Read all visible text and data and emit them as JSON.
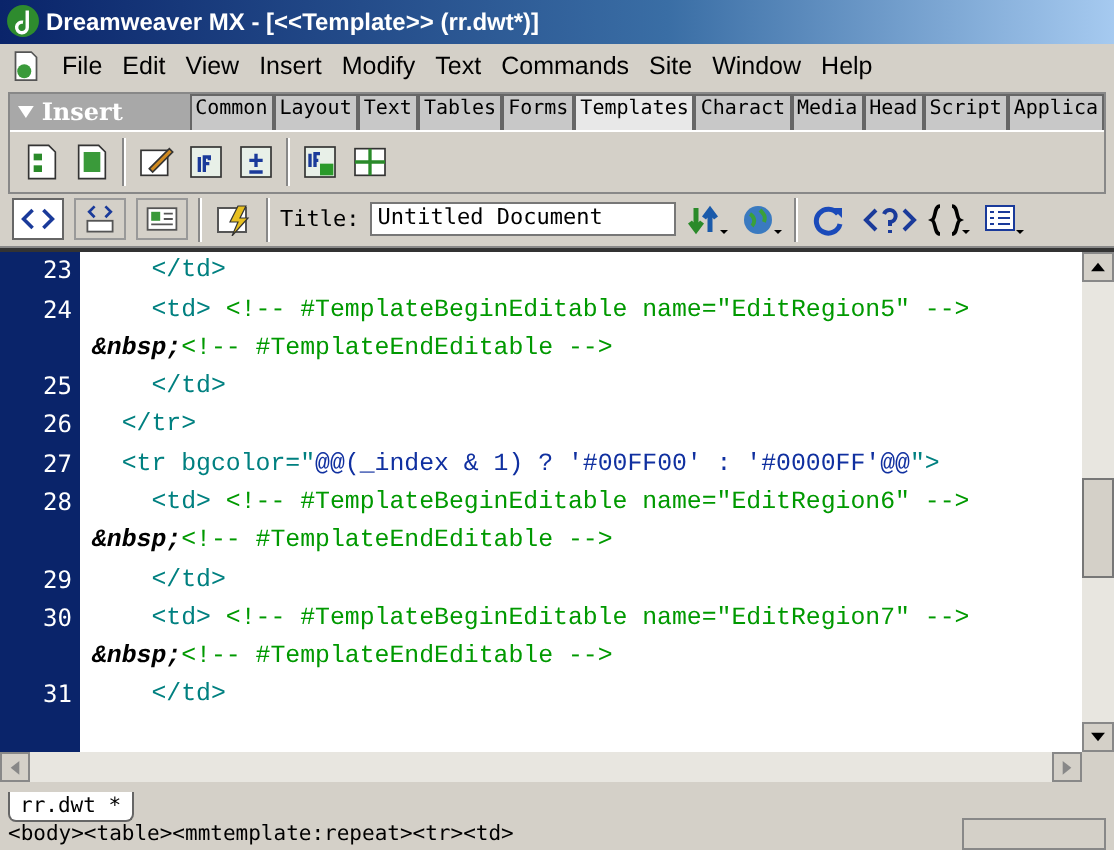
{
  "window": {
    "title": "Dreamweaver MX - [<<Template>>  (rr.dwt*)]"
  },
  "menu": [
    "File",
    "Edit",
    "View",
    "Insert",
    "Modify",
    "Text",
    "Commands",
    "Site",
    "Window",
    "Help"
  ],
  "insert_panel": {
    "title": "Insert",
    "tabs": [
      {
        "label": "Common",
        "selected": false
      },
      {
        "label": "Layout",
        "selected": false
      },
      {
        "label": "Text",
        "selected": false
      },
      {
        "label": "Tables",
        "selected": false
      },
      {
        "label": "Forms",
        "selected": false
      },
      {
        "label": "Templates",
        "selected": true
      },
      {
        "label": "Charact",
        "selected": false
      },
      {
        "label": "Media",
        "selected": false
      },
      {
        "label": "Head",
        "selected": false
      },
      {
        "label": "Script",
        "selected": false
      },
      {
        "label": "Applica",
        "selected": false
      }
    ]
  },
  "document_toolbar": {
    "views": [
      {
        "kind": "code",
        "selected": true
      },
      {
        "kind": "split",
        "selected": false
      },
      {
        "kind": "design",
        "selected": false
      }
    ],
    "title_label": "Title:",
    "title_value": "Untitled Document"
  },
  "code_lines": [
    {
      "number": "23",
      "segments": [
        {
          "kind": "tag",
          "text": "    </td>"
        }
      ]
    },
    {
      "number": "24",
      "segments": [
        {
          "kind": "tag",
          "text": "    <td> "
        },
        {
          "kind": "comment",
          "text": "<!-- #TemplateBeginEditable name=\"EditRegion5\" -->"
        }
      ]
    },
    {
      "segments": [
        {
          "kind": "entity",
          "text": "&nbsp;"
        },
        {
          "kind": "comment",
          "text": "<!-- #TemplateEndEditable -->"
        }
      ]
    },
    {
      "number": "25",
      "segments": [
        {
          "kind": "tag",
          "text": "    </td>"
        }
      ]
    },
    {
      "number": "26",
      "segments": [
        {
          "kind": "tag",
          "text": "  </tr>"
        }
      ]
    },
    {
      "number": "27",
      "segments": [
        {
          "kind": "tag",
          "text": "  <tr bgcolor=\""
        },
        {
          "kind": "expression",
          "text": "@@(_index & 1) ? '#00FF00' : '#0000FF'@@"
        },
        {
          "kind": "tag",
          "text": "\">"
        }
      ]
    },
    {
      "number": "28",
      "segments": [
        {
          "kind": "tag",
          "text": "    <td> "
        },
        {
          "kind": "comment",
          "text": "<!-- #TemplateBeginEditable name=\"EditRegion6\" -->"
        }
      ]
    },
    {
      "segments": [
        {
          "kind": "entity",
          "text": "&nbsp;"
        },
        {
          "kind": "comment",
          "text": "<!-- #TemplateEndEditable -->"
        }
      ]
    },
    {
      "number": "29",
      "segments": [
        {
          "kind": "tag",
          "text": "    </td>"
        }
      ]
    },
    {
      "number": "30",
      "segments": [
        {
          "kind": "tag",
          "text": "    <td> "
        },
        {
          "kind": "comment",
          "text": "<!-- #TemplateBeginEditable name=\"EditRegion7\" -->"
        }
      ]
    },
    {
      "segments": [
        {
          "kind": "entity",
          "text": "&nbsp;"
        },
        {
          "kind": "comment",
          "text": "<!-- #TemplateEndEditable -->"
        }
      ]
    },
    {
      "number": "31",
      "segments": [
        {
          "kind": "tag",
          "text": "    </td>"
        }
      ]
    }
  ],
  "document_tab": "rr.dwt *",
  "tag_selector": "<body><table><mmtemplate:repeat><tr><td>"
}
